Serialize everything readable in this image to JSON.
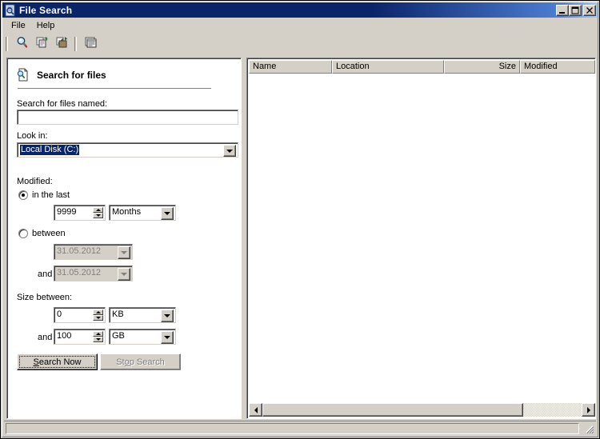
{
  "window": {
    "title": "File Search",
    "icon": "file-search-document-icon",
    "controls": {
      "minimize": "_",
      "maximize": "☐",
      "close": "×"
    }
  },
  "menu": {
    "items": [
      {
        "label": "File",
        "name": "menu-file"
      },
      {
        "label": "Help",
        "name": "menu-help"
      }
    ]
  },
  "toolbar": {
    "buttons": [
      {
        "name": "search-icon",
        "tip": "Search"
      },
      {
        "name": "copy-icon",
        "tip": "Copy"
      },
      {
        "name": "move-icon",
        "tip": "Move"
      },
      {
        "name": "properties-icon",
        "tip": "Properties"
      }
    ]
  },
  "search_panel": {
    "heading": "Search for files",
    "heading_icon": "search-document-icon",
    "named_label": "Search for files named:",
    "named_value": "",
    "named_placeholder": "",
    "lookin_label": "Look in:",
    "lookin_value": "Local Disk (C:)",
    "modified_label": "Modified:",
    "radio_inlast": "in the last",
    "radio_between": "between",
    "inlast_count": "9999",
    "inlast_unit": "Months",
    "between_from": "31.05.2012",
    "between_and_label": "and",
    "between_to": "31.05.2012",
    "size_label": "Size between:",
    "size_from_value": "0",
    "size_from_unit": "KB",
    "size_and_label": "and",
    "size_to_value": "100",
    "size_to_unit": "GB",
    "search_now_pre": "S",
    "search_now_post": "earch Now",
    "stop_search_pre": "St",
    "stop_search_mid": "o",
    "stop_search_post": "p Search"
  },
  "results": {
    "columns": [
      {
        "label": "Name",
        "align": "left"
      },
      {
        "label": "Location",
        "align": "left"
      },
      {
        "label": "Size",
        "align": "right"
      },
      {
        "label": "Modified",
        "align": "left"
      }
    ],
    "rows": []
  },
  "statusbar": {
    "text": ""
  },
  "colors": {
    "title_start": "#0a246a",
    "title_end": "#a6caf0",
    "face": "#d4d0c8",
    "selection": "#0a246a",
    "disabled_text": "#808080",
    "window_bg": "#ffffff"
  }
}
